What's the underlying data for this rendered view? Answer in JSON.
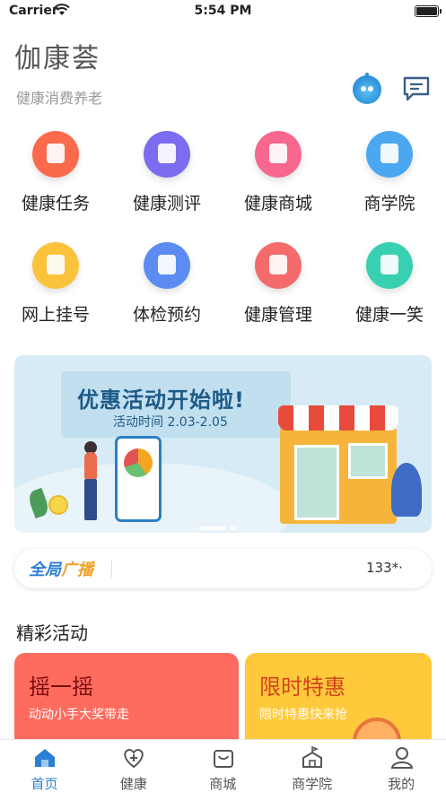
{
  "status_bar": {
    "carrier": "Carrier",
    "time": "5:54 PM"
  },
  "header": {
    "title": "伽康荟",
    "subtitle": "健康消费养老"
  },
  "icons": {
    "robot": "robot-icon",
    "message": "message-icon"
  },
  "grid_items": [
    {
      "label": "健康任务",
      "icon": "task-icon",
      "color": "#fa6a4b"
    },
    {
      "label": "健康测评",
      "icon": "evaluation-icon",
      "color": "#7b6cf0"
    },
    {
      "label": "健康商城",
      "icon": "shop-bag-icon",
      "color": "#f7678e"
    },
    {
      "label": "商学院",
      "icon": "school-icon",
      "color": "#4ba8f0"
    },
    {
      "label": "网上挂号",
      "icon": "calendar-icon",
      "color": "#fbc33c"
    },
    {
      "label": "体检预约",
      "icon": "checkup-icon",
      "color": "#5c8cf2"
    },
    {
      "label": "健康管理",
      "icon": "layers-icon",
      "color": "#f46b6b"
    },
    {
      "label": "健康一笑",
      "icon": "smile-icon",
      "color": "#38d0b1"
    }
  ],
  "banner": {
    "headline": "优惠活动开始啦!",
    "dates": "活动时间 2.03-2.05"
  },
  "broadcast": {
    "tag_part1": "全局",
    "tag_part2": "广播",
    "news": "133*·"
  },
  "section": {
    "title": "精彩活动"
  },
  "cards": [
    {
      "title": "摇一摇",
      "subtitle": "动动小手大奖带走"
    },
    {
      "title": "限时特惠",
      "subtitle": "限时特惠快来抢"
    }
  ],
  "tabs": [
    {
      "label": "首页",
      "icon": "home-icon",
      "active": true
    },
    {
      "label": "健康",
      "icon": "health-heart-icon",
      "active": false
    },
    {
      "label": "商城",
      "icon": "shop-icon",
      "active": false
    },
    {
      "label": "商学院",
      "icon": "school-icon",
      "active": false
    },
    {
      "label": "我的",
      "icon": "profile-icon",
      "active": false
    }
  ],
  "colors": {
    "accent": "#2b7fd4",
    "tab_inactive": "#555555"
  }
}
